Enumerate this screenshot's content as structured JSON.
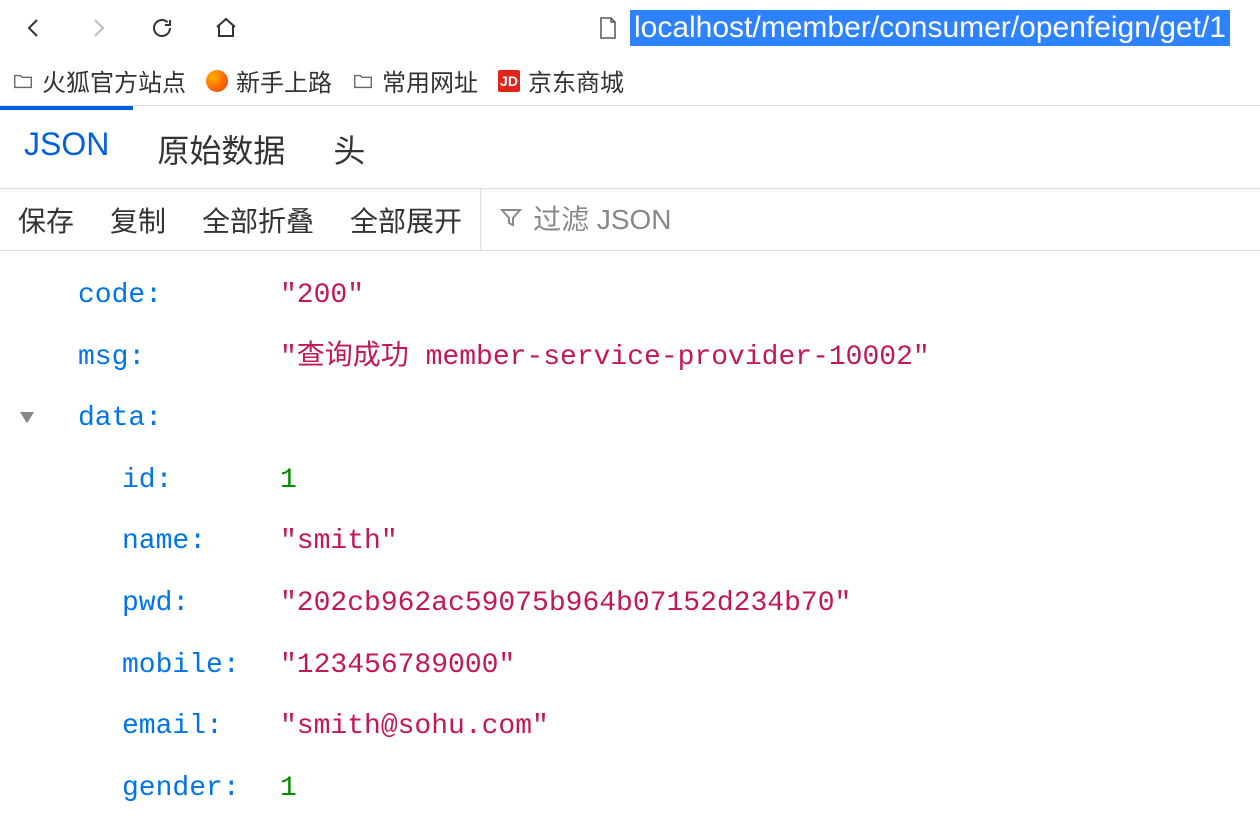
{
  "toolbar": {
    "url": "localhost/member/consumer/openfeign/get/1"
  },
  "bookmarks": [
    {
      "label": "火狐官方站点",
      "icon": "folder"
    },
    {
      "label": "新手上路",
      "icon": "firefox"
    },
    {
      "label": "常用网址",
      "icon": "folder"
    },
    {
      "label": "京东商城",
      "icon": "jd",
      "badge": "JD"
    }
  ],
  "view_tabs": {
    "json": "JSON",
    "raw": "原始数据",
    "headers": "头"
  },
  "actions": {
    "save": "保存",
    "copy": "复制",
    "collapse_all": "全部折叠",
    "expand_all": "全部展开",
    "filter_placeholder": "过滤 JSON"
  },
  "json_response": {
    "rows": [
      {
        "key": "code:",
        "value": "\"200\"",
        "type": "string",
        "indent": 1,
        "arrow": false
      },
      {
        "key": "msg:",
        "value": "\"查询成功 member-service-provider-10002\"",
        "type": "string",
        "indent": 1,
        "arrow": false
      },
      {
        "key": "data:",
        "value": "",
        "type": "object",
        "indent": 1,
        "arrow": true
      },
      {
        "key": "id:",
        "value": "1",
        "type": "number",
        "indent": 2,
        "arrow": false
      },
      {
        "key": "name:",
        "value": "\"smith\"",
        "type": "string",
        "indent": 2,
        "arrow": false
      },
      {
        "key": "pwd:",
        "value": "\"202cb962ac59075b964b07152d234b70\"",
        "type": "string",
        "indent": 2,
        "arrow": false
      },
      {
        "key": "mobile:",
        "value": "\"123456789000\"",
        "type": "string",
        "indent": 2,
        "arrow": false
      },
      {
        "key": "email:",
        "value": "\"smith@sohu.com\"",
        "type": "string",
        "indent": 2,
        "arrow": false
      },
      {
        "key": "gender:",
        "value": "1",
        "type": "number",
        "indent": 2,
        "arrow": false
      }
    ]
  }
}
